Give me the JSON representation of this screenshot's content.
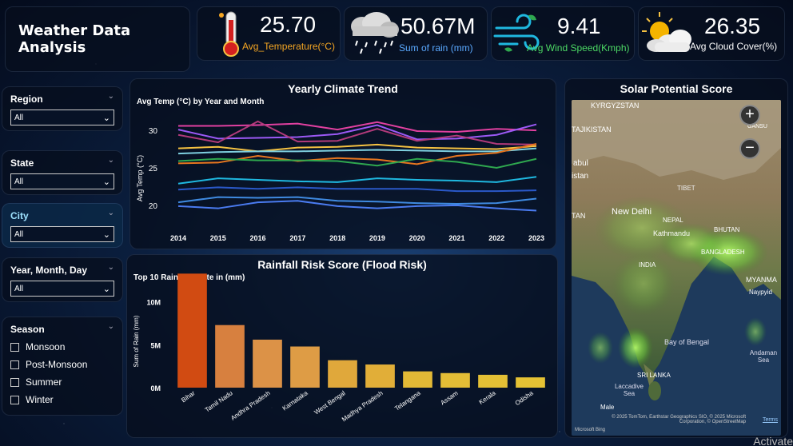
{
  "header": {
    "title": "Weather Data Analysis"
  },
  "kpis": [
    {
      "value": "25.70",
      "label": "Avg_Temperature(°C)",
      "icon": "thermometer-icon",
      "label_color": "#f5a623"
    },
    {
      "value": "50.67M",
      "label": "Sum of rain (mm)",
      "icon": "rain-cloud-icon",
      "label_color": "#5aa9ff"
    },
    {
      "value": "9.41",
      "label": "Avg Wind Speed(Kmph)",
      "icon": "wind-icon",
      "label_color": "#4cd964"
    },
    {
      "value": "26.35",
      "label": "Avg Cloud Cover(%)",
      "icon": "sun-cloud-icon",
      "label_color": "#ffffff"
    }
  ],
  "filters": [
    {
      "label": "Region",
      "value": "All"
    },
    {
      "label": "State",
      "value": "All"
    },
    {
      "label": "City",
      "value": "All"
    },
    {
      "label": "Year, Month, Day",
      "value": "All"
    }
  ],
  "season": {
    "label": "Season",
    "options": [
      "Monsoon",
      "Post-Monsoon",
      "Summer",
      "Winter"
    ]
  },
  "line_chart_panel": {
    "title": "Yearly Climate Trend",
    "subtitle": "Avg Temp (°C) by Year and Month"
  },
  "bar_chart_panel": {
    "title": "Rainfall Risk Score (Flood Risk)",
    "subtitle": "Top 10 Rainiest State in (mm)"
  },
  "map_panel": {
    "title": "Solar Potential Score",
    "zoom_in": "+",
    "zoom_out": "−",
    "labels": [
      "KYRGYZSTAN",
      "TAJIKISTAN",
      "abul",
      "istan",
      "TIBET",
      "New Delhi",
      "NEPAL",
      "Kathmandu",
      "BHUTAN",
      "BANGLADESH",
      "INDIA",
      "MYANMA",
      "Naypyid",
      "Bay of Bengal",
      "Andaman Sea",
      "SRI LANKA",
      "Laccadive Sea",
      "Male",
      "GANSU",
      "TAN"
    ],
    "attribution": "© 2025 TomTom, Earthstar Geographics SIO, © 2025 Microsoft Corporation, © OpenStreetMap",
    "terms": "Terms",
    "bing": "Microsoft Bing"
  },
  "watermark": "Activate",
  "chart_data": [
    {
      "type": "line",
      "title": "Avg Temp (°C) by Year and Month",
      "xlabel": "",
      "ylabel": "Avg Temp (°C)",
      "x": [
        2014,
        2015,
        2016,
        2017,
        2018,
        2019,
        2020,
        2021,
        2022,
        2023
      ],
      "ylim": [
        18.5,
        31.5
      ],
      "yticks": [
        20,
        25,
        30
      ],
      "series": [
        {
          "color": "#e040a0",
          "values": [
            30.6,
            30.6,
            30.7,
            30.9,
            30.1,
            31.1,
            29.9,
            29.8,
            30.2,
            30.0
          ]
        },
        {
          "color": "#9b59f5",
          "values": [
            30.1,
            28.9,
            29.0,
            29.1,
            29.5,
            30.7,
            28.8,
            28.9,
            29.4,
            30.8
          ]
        },
        {
          "color": "#b03a7a",
          "values": [
            29.4,
            28.4,
            31.2,
            28.5,
            28.6,
            30.2,
            28.6,
            29.3,
            28.2,
            28.1
          ]
        },
        {
          "color": "#f5c242",
          "values": [
            27.6,
            27.8,
            27.2,
            27.7,
            27.8,
            28.1,
            27.7,
            27.6,
            27.5,
            27.9
          ]
        },
        {
          "color": "#7fd0e0",
          "values": [
            26.9,
            27.1,
            27.2,
            27.2,
            27.3,
            27.4,
            27.3,
            27.2,
            27.2,
            27.6
          ]
        },
        {
          "color": "#e8761f",
          "values": [
            25.6,
            25.7,
            26.6,
            25.9,
            26.3,
            26.1,
            25.5,
            26.6,
            27.0,
            28.2
          ]
        },
        {
          "color": "#2fa84f",
          "values": [
            25.9,
            26.2,
            26.0,
            26.0,
            25.9,
            25.3,
            26.2,
            25.8,
            25.0,
            26.2
          ]
        },
        {
          "color": "#1fb8e0",
          "values": [
            22.9,
            23.6,
            23.4,
            23.2,
            23.1,
            23.6,
            23.4,
            23.3,
            23.1,
            23.8
          ]
        },
        {
          "color": "#2a58c8",
          "values": [
            22.1,
            22.4,
            22.2,
            22.4,
            22.2,
            22.2,
            22.2,
            21.9,
            21.9,
            22.0
          ]
        },
        {
          "color": "#3f8ae0",
          "values": [
            20.4,
            21.1,
            21.0,
            21.1,
            20.6,
            20.5,
            20.3,
            20.2,
            20.3,
            20.9
          ]
        },
        {
          "color": "#4a7bf0",
          "values": [
            19.9,
            19.6,
            20.4,
            20.6,
            19.9,
            19.6,
            19.9,
            20.0,
            19.6,
            19.3
          ]
        }
      ]
    },
    {
      "type": "bar",
      "title": "Top 10 Rainiest State in (mm)",
      "xlabel": "",
      "ylabel": "Sum of Rain (mm)",
      "ylim": [
        0,
        11000000
      ],
      "yticks": [
        {
          "value": 0,
          "label": "0M"
        },
        {
          "value": 5000000,
          "label": "5M"
        },
        {
          "value": 10000000,
          "label": "10M"
        }
      ],
      "categories": [
        "Bihar",
        "Tamil Nadu",
        "Andhra Pradesh",
        "Karnataka",
        "West Bengal",
        "Madhya Pradesh",
        "Telangana",
        "Assam",
        "Kerala",
        "Odisha"
      ],
      "values": [
        13300000,
        7300000,
        5600000,
        4800000,
        3200000,
        2700000,
        1900000,
        1700000,
        1500000,
        1200000
      ],
      "colors": [
        "#d14b12",
        "#d7803f",
        "#dc9247",
        "#de9c45",
        "#e0a83b",
        "#e1ae38",
        "#e2b936",
        "#e3bd36",
        "#e4c035",
        "#e5c234"
      ]
    }
  ]
}
